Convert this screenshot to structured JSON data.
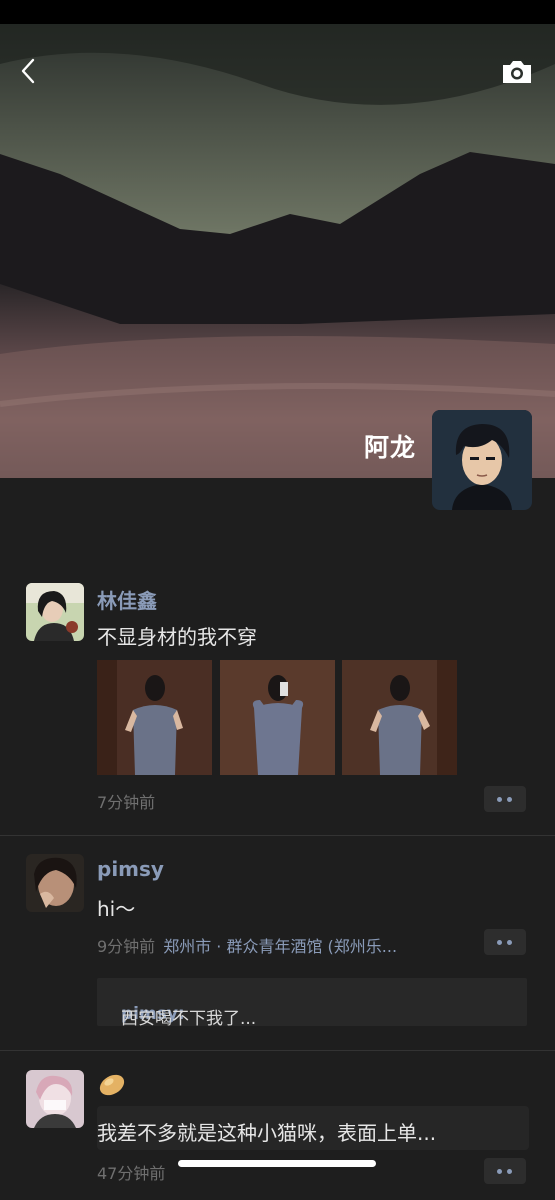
{
  "header": {
    "back_icon": "chevron-left-icon",
    "camera_icon": "camera-icon",
    "profile_name": "阿龙"
  },
  "posts": [
    {
      "nickname": "林佳鑫",
      "text": "不显身材的我不穿",
      "time": "7分钟前",
      "photos": [
        "photo-1",
        "photo-2",
        "photo-3"
      ]
    },
    {
      "nickname": "pimsy",
      "text": "hi～",
      "time": "9分钟前",
      "location": "郑州市 · 群众青年酒馆 (郑州乐...",
      "comment": {
        "name": "pimsy:",
        "text": "西安喝不下我了..."
      }
    },
    {
      "text": "我差不多就是这种小猫咪，表面上单...",
      "time": "47分钟前"
    }
  ],
  "colors": {
    "background": "#1e1e1e",
    "nickname": "#8a9bb8",
    "body_text": "#e6e6e6",
    "muted": "#6f6f6f"
  }
}
